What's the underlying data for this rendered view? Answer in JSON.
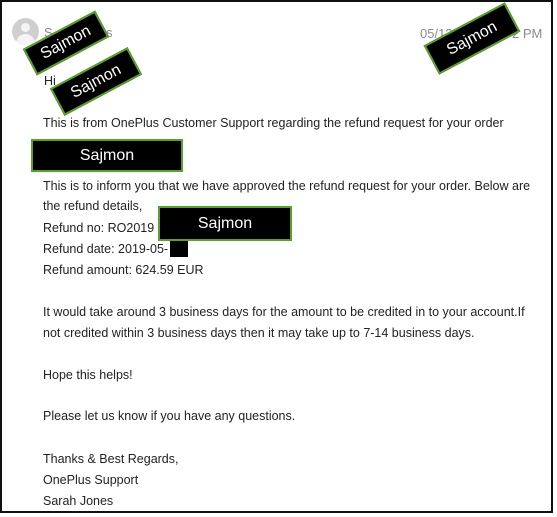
{
  "sender": {
    "name": "S",
    "name_tail": "s",
    "date": "05/12",
    "time_tail": "2 PM"
  },
  "greeting": "Hi",
  "body": {
    "intro": "This is from OnePlus Customer Support regarding the refund request for your order",
    "inform_1": "This is to inform you that we have approved the refund request for your order. Below are",
    "inform_2": "the refund details,",
    "refund_no": "Refund no: RO2019",
    "refund_date": "Refund date: 2019-05-",
    "refund_amount": "Refund amount: 624.59 EUR",
    "timing_1": "It would take around 3 business days for the amount to be credited in to your account.If",
    "timing_2": "not credited within 3 business days then it may take up to 7-14 business days.",
    "hope": "Hope this helps!",
    "questions": "Please let us know if you have any questions.",
    "closing_1": "Thanks & Best Regards,",
    "closing_2": "OnePlus Support",
    "closing_3": "Sarah Jones"
  },
  "watermarks": [
    "Sajmon",
    "Sajmon",
    "Sajmon",
    "Sajmon",
    "Sajmon"
  ],
  "colors": {
    "tag_bg": "#000000",
    "tag_border": "#5aa02c",
    "text": "#222222",
    "meta": "#8a8a8a"
  }
}
